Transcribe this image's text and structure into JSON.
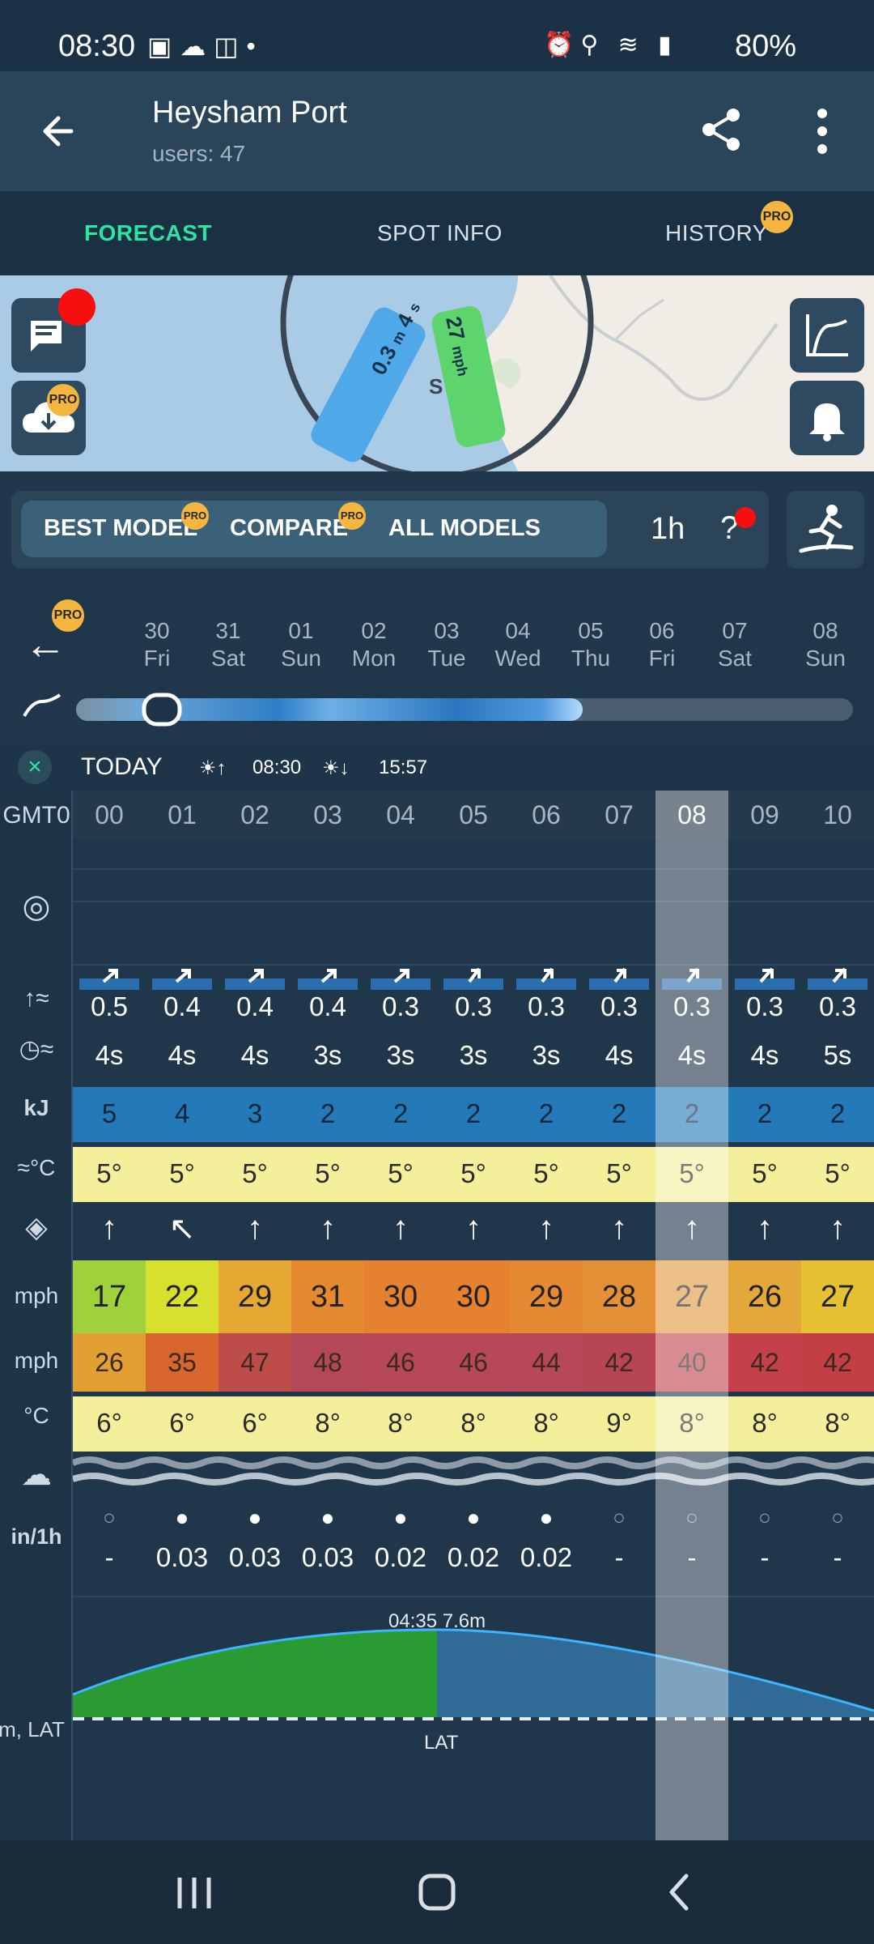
{
  "status": {
    "time": "08:30",
    "battery": "80%"
  },
  "header": {
    "title": "Heysham Port",
    "subtitle": "users: 47"
  },
  "tabs": [
    {
      "label": "FORECAST",
      "active": true
    },
    {
      "label": "SPOT INFO",
      "active": false
    },
    {
      "label": "HISTORY",
      "active": false,
      "badge": "PRO"
    }
  ],
  "map": {
    "wave_tag": {
      "height": "0.3",
      "unit": "m",
      "period": "4",
      "period_unit": "s"
    },
    "wind_tag": {
      "speed": "27",
      "unit": "mph"
    },
    "spot_letter": "S"
  },
  "pro_badge": "PRO",
  "models": {
    "best": "BEST MODEL",
    "compare": "COMPARE",
    "all": "ALL MODELS",
    "interval": "1h",
    "help": "?"
  },
  "days": [
    {
      "num": "30",
      "name": "Fri"
    },
    {
      "num": "31",
      "name": "Sat"
    },
    {
      "num": "01",
      "name": "Sun"
    },
    {
      "num": "02",
      "name": "Mon"
    },
    {
      "num": "03",
      "name": "Tue"
    },
    {
      "num": "04",
      "name": "Wed"
    },
    {
      "num": "05",
      "name": "Thu"
    },
    {
      "num": "06",
      "name": "Fri"
    },
    {
      "num": "07",
      "name": "Sat"
    },
    {
      "num": "08",
      "name": "Sun"
    }
  ],
  "today": {
    "label": "TODAY",
    "sunrise": "08:30",
    "sunset": "15:57"
  },
  "table": {
    "timezone_label": "GMT0",
    "hours": [
      "00",
      "01",
      "02",
      "03",
      "04",
      "05",
      "06",
      "07",
      "08",
      "09",
      "10"
    ],
    "highlight_hour": "08",
    "wave_height": [
      "0.5",
      "0.4",
      "0.4",
      "0.4",
      "0.3",
      "0.3",
      "0.3",
      "0.3",
      "0.3",
      "0.3",
      "0.3"
    ],
    "wave_period": [
      "4s",
      "4s",
      "4s",
      "3s",
      "3s",
      "3s",
      "3s",
      "4s",
      "4s",
      "4s",
      "5s"
    ],
    "energy_label": "kJ",
    "energy": [
      "5",
      "4",
      "3",
      "2",
      "2",
      "2",
      "2",
      "2",
      "2",
      "2",
      "2"
    ],
    "water_temp_label": "≈°C",
    "water_temp": [
      "5°",
      "5°",
      "5°",
      "5°",
      "5°",
      "5°",
      "5°",
      "5°",
      "5°",
      "5°",
      "5°"
    ],
    "wind_dir_glyphs": [
      "↑",
      "↖",
      "↑",
      "↑",
      "↑",
      "↑",
      "↑",
      "↑",
      "↑",
      "↑",
      "↑"
    ],
    "wind_speed_label": "mph",
    "wind_speed": [
      "17",
      "22",
      "29",
      "31",
      "30",
      "30",
      "29",
      "28",
      "27",
      "26",
      "27"
    ],
    "gust_label": "mph",
    "gust": [
      "26",
      "35",
      "47",
      "48",
      "46",
      "46",
      "44",
      "42",
      "40",
      "42",
      "42"
    ],
    "air_temp_label": "°C",
    "air_temp": [
      "6°",
      "6°",
      "6°",
      "8°",
      "8°",
      "8°",
      "8°",
      "9°",
      "8°",
      "8°",
      "8°"
    ],
    "precip_label": "in/1h",
    "precip": [
      "-",
      "0.03",
      "0.03",
      "0.03",
      "0.02",
      "0.02",
      "0.02",
      "-",
      "-",
      "-",
      "-"
    ],
    "tide": {
      "peak_label": "04:35 7.6m",
      "axis_label": "m, LAT",
      "datum_label": "LAT"
    }
  },
  "colors": {
    "accent": "#2fe3a3",
    "energy_bg": "#2479b8",
    "water_temp_bg": "#f3ef9b",
    "air_temp_bg": "#f3ef9b",
    "wind": [
      "#9fd23a",
      "#d7e02c",
      "#e7a733",
      "#e68a2f",
      "#e6822f",
      "#e6822f",
      "#e58a32",
      "#e49037",
      "#e39a40",
      "#e4a83a",
      "#e6c233"
    ],
    "gust": [
      "#e3a032",
      "#d9662e",
      "#be4d4a",
      "#b5475a",
      "#b64858",
      "#b64858",
      "#b7475a",
      "#b84552",
      "#c0444d",
      "#c4404a",
      "#c43f45"
    ]
  }
}
